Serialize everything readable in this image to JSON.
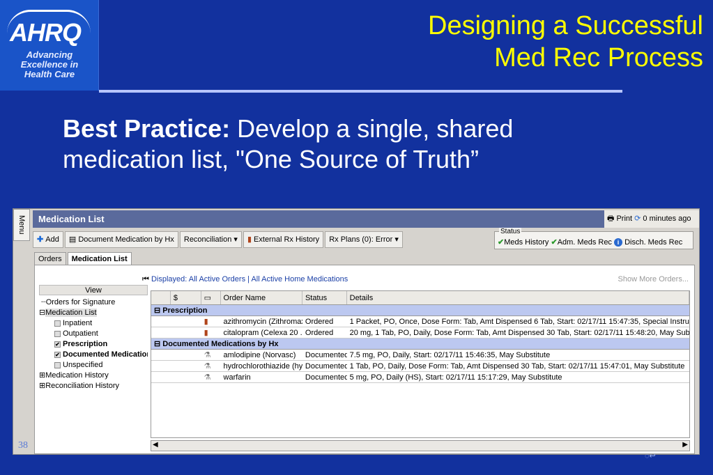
{
  "logo": {
    "mark": "AHRQ",
    "tagline_1": "Advancing",
    "tagline_2": "Excellence in",
    "tagline_3": "Health Care"
  },
  "slide": {
    "title_line1": "Designing a Successful",
    "title_line2": "Med Rec Process",
    "bp_bold": "Best Practice:",
    "bp_text": " Develop a single, shared medication list, \"One Source of Truth”",
    "page_number": "38"
  },
  "app": {
    "menu_label": "Menu",
    "header_title": "Medication List",
    "print_label": "Print",
    "refresh_label": "0 minutes ago",
    "toolbar": {
      "add": "Add",
      "document_by_hx": "Document Medication by Hx",
      "reconciliation": "Reconciliation ▾",
      "external_rx": "External Rx History",
      "rx_plans": "Rx Plans (0): Error ▾"
    },
    "status": {
      "legend": "Status",
      "meds_history": "Meds History",
      "adm_meds_rec": "Adm. Meds Rec",
      "disch_meds_rec": "Disch. Meds Rec"
    },
    "tabs": [
      "Orders",
      "Medication List"
    ],
    "tree": {
      "head": "View",
      "items": [
        "Orders for Signature",
        "Medication List",
        "Inpatient",
        "Outpatient",
        "Prescription",
        "Documented Medications by Hx",
        "Unspecified",
        "Medication History",
        "Reconciliation History"
      ]
    },
    "displayed": {
      "label": "Displayed:",
      "all_active_orders": "All Active Orders",
      "sep": "|",
      "all_active_home": "All Active Home Medications"
    },
    "show_more": "Show More Orders...",
    "grid": {
      "columns": [
        "",
        "$",
        "",
        "Order Name",
        "Status",
        "Details"
      ],
      "groups": [
        {
          "label": "Prescription",
          "rows": [
            {
              "name": "azithromycin (Zithromax...",
              "status": "Ordered",
              "details": "1 Packet, PO, Once, Dose Form: Tab, Amt Dispensed 6 Tab, Start: 02/17/11 15:47:35, Special Instructions: a..."
            },
            {
              "name": "citalopram (Celexa 20 ...",
              "status": "Ordered",
              "details": "20 mg, 1 Tab, PO, Daily, Dose Form: Tab, Amt Dispensed 30 Tab, Start: 02/17/11 15:48:20, May Substitute"
            }
          ]
        },
        {
          "label": "Documented Medications by Hx",
          "rows": [
            {
              "name": "amlodipine (Norvasc)",
              "status": "Documented",
              "details": "7.5 mg, PO, Daily, Start: 02/17/11 15:46:35, May Substitute"
            },
            {
              "name": "hydrochlorothiazide (hy...",
              "status": "Documented",
              "details": "1 Tab, PO, Daily, Dose Form: Tab, Amt Dispensed 30 Tab, Start: 02/17/11 15:47:01, May Substitute"
            },
            {
              "name": "warfarin",
              "status": "Documented",
              "details": "5 mg, PO, Daily (HS), Start: 02/17/11 15:17:29, May Substitute"
            }
          ]
        }
      ]
    }
  }
}
